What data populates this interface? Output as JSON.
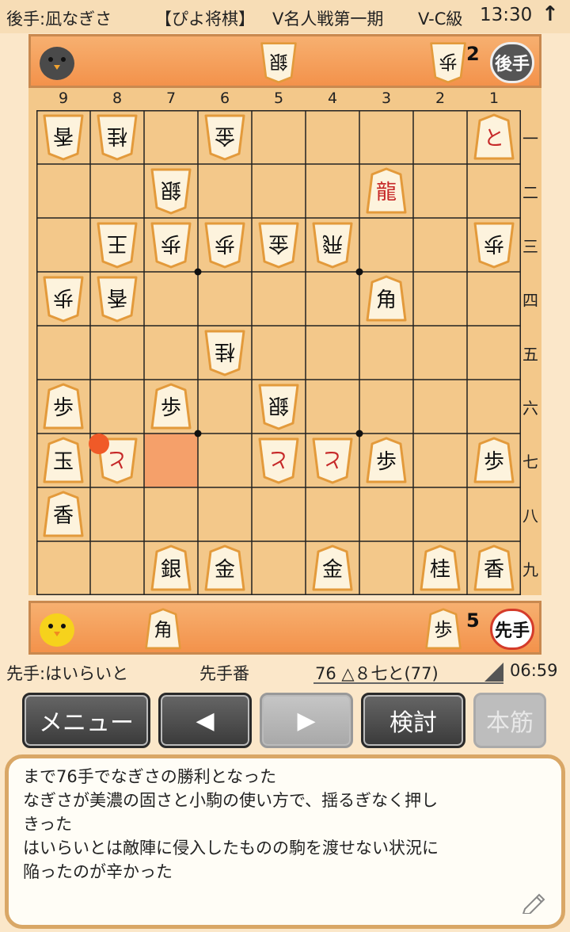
{
  "header": {
    "gote_player": "後手:凪なぎさ",
    "app_name": "【ぴよ将棋】",
    "event": "V名人戦第一期",
    "class": "V-C級",
    "time": "13:30",
    "arrow": "↑"
  },
  "gote_hand": {
    "pieces": [
      {
        "kanji": "銀",
        "count": ""
      },
      {
        "kanji": "歩",
        "count": "2"
      }
    ],
    "badge": "後手"
  },
  "sente_hand": {
    "pieces": [
      {
        "kanji": "角",
        "count": ""
      },
      {
        "kanji": "歩",
        "count": "5"
      }
    ],
    "badge": "先手"
  },
  "board": {
    "files": [
      "9",
      "8",
      "7",
      "6",
      "5",
      "4",
      "3",
      "2",
      "1"
    ],
    "ranks": [
      "一",
      "二",
      "三",
      "四",
      "五",
      "六",
      "七",
      "八",
      "九"
    ],
    "last_move": {
      "file": 7,
      "rank": 7
    },
    "pieces": [
      {
        "file": 9,
        "rank": 1,
        "kanji": "香",
        "owner": "gote",
        "promoted": false
      },
      {
        "file": 8,
        "rank": 1,
        "kanji": "桂",
        "owner": "gote",
        "promoted": false
      },
      {
        "file": 6,
        "rank": 1,
        "kanji": "金",
        "owner": "gote",
        "promoted": false
      },
      {
        "file": 1,
        "rank": 1,
        "kanji": "と",
        "owner": "sente",
        "promoted": true
      },
      {
        "file": 7,
        "rank": 2,
        "kanji": "銀",
        "owner": "gote",
        "promoted": false
      },
      {
        "file": 3,
        "rank": 2,
        "kanji": "龍",
        "owner": "sente",
        "promoted": true
      },
      {
        "file": 8,
        "rank": 3,
        "kanji": "王",
        "owner": "gote",
        "promoted": false
      },
      {
        "file": 7,
        "rank": 3,
        "kanji": "歩",
        "owner": "gote",
        "promoted": false
      },
      {
        "file": 6,
        "rank": 3,
        "kanji": "歩",
        "owner": "gote",
        "promoted": false
      },
      {
        "file": 5,
        "rank": 3,
        "kanji": "金",
        "owner": "gote",
        "promoted": false
      },
      {
        "file": 4,
        "rank": 3,
        "kanji": "飛",
        "owner": "gote",
        "promoted": false
      },
      {
        "file": 1,
        "rank": 3,
        "kanji": "歩",
        "owner": "gote",
        "promoted": false
      },
      {
        "file": 9,
        "rank": 4,
        "kanji": "歩",
        "owner": "gote",
        "promoted": false
      },
      {
        "file": 8,
        "rank": 4,
        "kanji": "香",
        "owner": "gote",
        "promoted": false
      },
      {
        "file": 3,
        "rank": 4,
        "kanji": "角",
        "owner": "sente",
        "promoted": false
      },
      {
        "file": 6,
        "rank": 5,
        "kanji": "桂",
        "owner": "gote",
        "promoted": false
      },
      {
        "file": 9,
        "rank": 6,
        "kanji": "歩",
        "owner": "sente",
        "promoted": false
      },
      {
        "file": 7,
        "rank": 6,
        "kanji": "歩",
        "owner": "sente",
        "promoted": false
      },
      {
        "file": 5,
        "rank": 6,
        "kanji": "銀",
        "owner": "gote",
        "promoted": false
      },
      {
        "file": 9,
        "rank": 7,
        "kanji": "玉",
        "owner": "sente",
        "promoted": false
      },
      {
        "file": 8,
        "rank": 7,
        "kanji": "と",
        "owner": "gote",
        "promoted": true
      },
      {
        "file": 5,
        "rank": 7,
        "kanji": "と",
        "owner": "gote",
        "promoted": true
      },
      {
        "file": 4,
        "rank": 7,
        "kanji": "と",
        "owner": "gote",
        "promoted": true
      },
      {
        "file": 3,
        "rank": 7,
        "kanji": "歩",
        "owner": "sente",
        "promoted": false
      },
      {
        "file": 1,
        "rank": 7,
        "kanji": "歩",
        "owner": "sente",
        "promoted": false
      },
      {
        "file": 9,
        "rank": 8,
        "kanji": "香",
        "owner": "sente",
        "promoted": false
      },
      {
        "file": 7,
        "rank": 9,
        "kanji": "銀",
        "owner": "sente",
        "promoted": false
      },
      {
        "file": 6,
        "rank": 9,
        "kanji": "金",
        "owner": "sente",
        "promoted": false
      },
      {
        "file": 4,
        "rank": 9,
        "kanji": "金",
        "owner": "sente",
        "promoted": false
      },
      {
        "file": 2,
        "rank": 9,
        "kanji": "桂",
        "owner": "sente",
        "promoted": false
      },
      {
        "file": 1,
        "rank": 9,
        "kanji": "香",
        "owner": "sente",
        "promoted": false
      }
    ]
  },
  "info": {
    "sente_player": "先手:はいらいと",
    "turn": "先手番",
    "move": "76 △８七と(77)",
    "clock": "06:59"
  },
  "buttons": {
    "menu": "メニュー",
    "prev": "◀",
    "next": "▶",
    "analyze": "検討",
    "mainline": "本筋"
  },
  "comment": {
    "lines": [
      "まで76手でなぎさの勝利となった",
      "なぎさが美濃の固さと小駒の使い方で、揺るぎなく押し",
      "きった",
      "はいらいとは敵陣に侵入したものの駒を渡せない状況に",
      "陥ったのが辛かった"
    ]
  },
  "colors": {
    "board": "#f3c88a",
    "hand_bar": "#f3924b",
    "promoted_text": "#c62828",
    "last_move": "#f58f5c"
  }
}
